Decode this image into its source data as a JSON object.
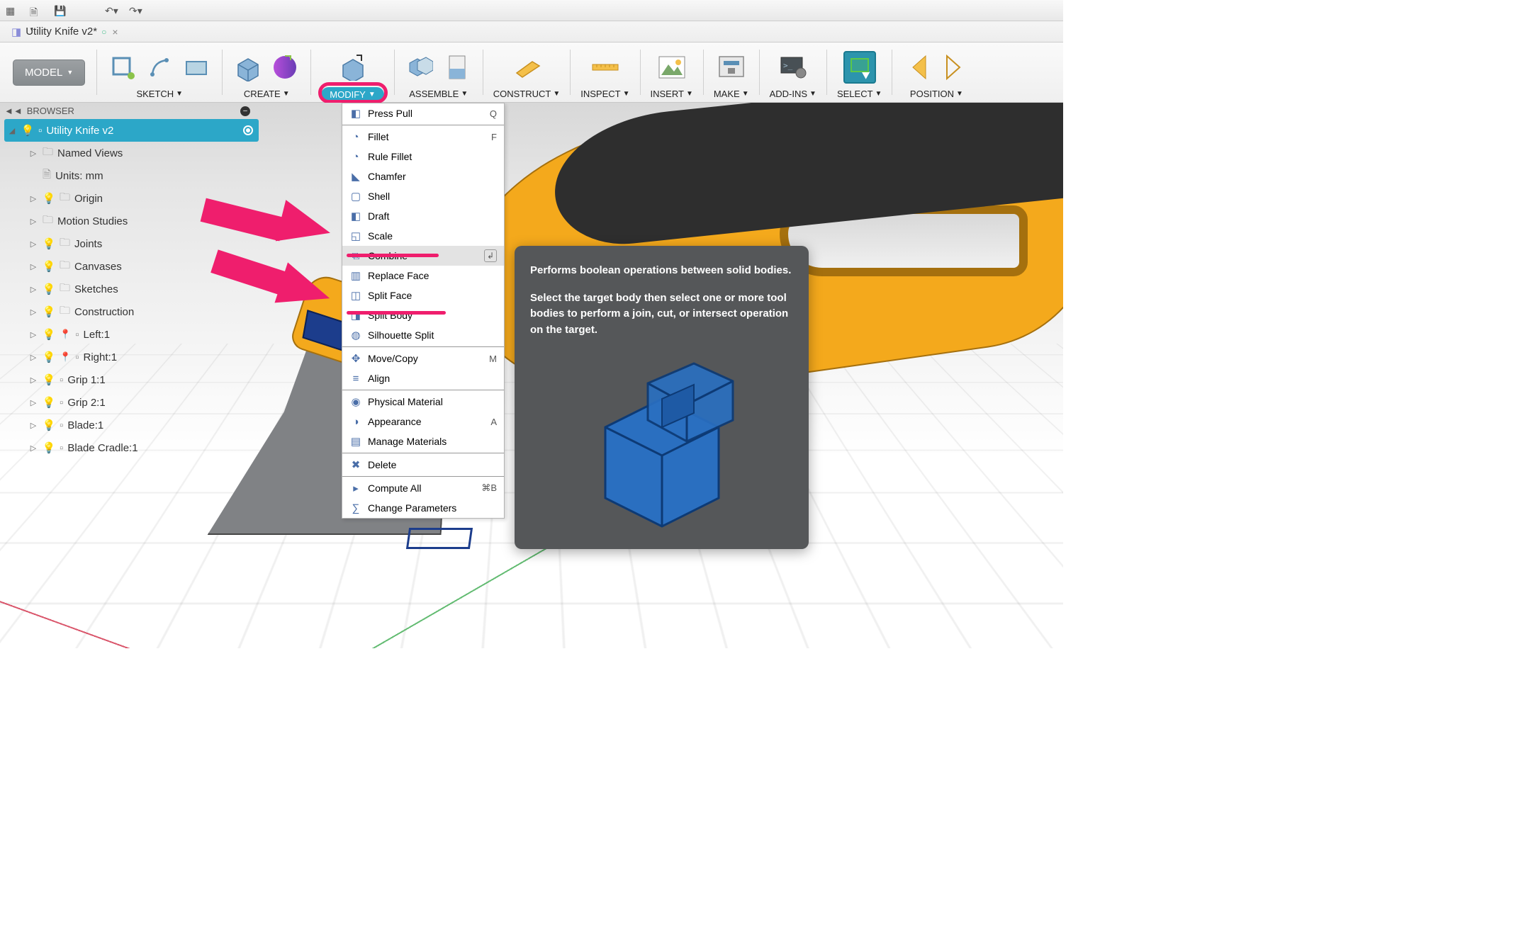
{
  "os_toolbar": {
    "icons": [
      "grid-icon",
      "new-doc-icon",
      "save-icon",
      "undo-icon",
      "redo-icon"
    ]
  },
  "tab": {
    "name": "Utility Knife v2*",
    "modified_indicator": "○",
    "close_label": "×"
  },
  "ribbon": {
    "model_button": "MODEL",
    "groups": [
      {
        "id": "sketch",
        "label": "SKETCH",
        "icons": [
          "sketch-create-icon",
          "sketch-spline-icon",
          "sketch-rect-icon"
        ]
      },
      {
        "id": "create",
        "label": "CREATE",
        "icons": [
          "extrude-icon",
          "sweep-icon"
        ]
      },
      {
        "id": "modify",
        "label": "MODIFY",
        "icons": [
          "presspull-icon"
        ]
      },
      {
        "id": "assemble",
        "label": "ASSEMBLE",
        "icons": [
          "joint-icon",
          "asbuilt-icon"
        ]
      },
      {
        "id": "construct",
        "label": "CONSTRUCT",
        "icons": [
          "plane-icon"
        ]
      },
      {
        "id": "inspect",
        "label": "INSPECT",
        "icons": [
          "measure-icon"
        ]
      },
      {
        "id": "insert",
        "label": "INSERT",
        "icons": [
          "image-icon"
        ]
      },
      {
        "id": "make",
        "label": "MAKE",
        "icons": [
          "print3d-icon"
        ]
      },
      {
        "id": "addins",
        "label": "ADD-INS",
        "icons": [
          "script-icon"
        ]
      },
      {
        "id": "select",
        "label": "SELECT",
        "icons": [
          "select-icon"
        ]
      },
      {
        "id": "position",
        "label": "POSITION",
        "icons": [
          "mirror-icon",
          "mirror2-icon"
        ]
      }
    ]
  },
  "browser": {
    "header_collapse_icon": "◄◄",
    "header_label": "BROWSER",
    "root": {
      "label": "Utility Knife v2"
    },
    "items": [
      {
        "type": "folder",
        "label": "Named Views",
        "expander": "▷",
        "indent": 1,
        "bulb": null
      },
      {
        "type": "doc",
        "label": "Units: mm",
        "expander": "",
        "indent": 1,
        "bulb": null
      },
      {
        "type": "folder",
        "label": "Origin",
        "expander": "▷",
        "indent": 1,
        "bulb": "off"
      },
      {
        "type": "folder",
        "label": "Motion Studies",
        "expander": "▷",
        "indent": 1,
        "bulb": null
      },
      {
        "type": "folder",
        "label": "Joints",
        "expander": "▷",
        "indent": 1,
        "bulb": "off"
      },
      {
        "type": "folder",
        "label": "Canvases",
        "expander": "▷",
        "indent": 1,
        "bulb": "off"
      },
      {
        "type": "folder",
        "label": "Sketches",
        "expander": "▷",
        "indent": 1,
        "bulb": "off"
      },
      {
        "type": "folder",
        "label": "Construction",
        "expander": "▷",
        "indent": 1,
        "bulb": "off"
      },
      {
        "type": "component",
        "label": "Left:1",
        "expander": "▷",
        "indent": 1,
        "bulb": "on",
        "pin": true
      },
      {
        "type": "component",
        "label": "Right:1",
        "expander": "▷",
        "indent": 1,
        "bulb": "on",
        "pin": true
      },
      {
        "type": "component",
        "label": "Grip 1:1",
        "expander": "▷",
        "indent": 1,
        "bulb": "on",
        "pin": false
      },
      {
        "type": "component",
        "label": "Grip 2:1",
        "expander": "▷",
        "indent": 1,
        "bulb": "on",
        "pin": false
      },
      {
        "type": "component",
        "label": "Blade:1",
        "expander": "▷",
        "indent": 1,
        "bulb": "on",
        "pin": false
      },
      {
        "type": "component",
        "label": "Blade Cradle:1",
        "expander": "▷",
        "indent": 1,
        "bulb": "on",
        "pin": false
      }
    ]
  },
  "dropdown": {
    "items": [
      {
        "label": "Press Pull",
        "icon": "◧",
        "shortcut": "Q",
        "hover": false
      },
      {
        "sep": true
      },
      {
        "label": "Fillet",
        "icon": "◔",
        "shortcut": "F"
      },
      {
        "label": "Rule Fillet",
        "icon": "◔"
      },
      {
        "label": "Chamfer",
        "icon": "◣"
      },
      {
        "label": "Shell",
        "icon": "▢"
      },
      {
        "label": "Draft",
        "icon": "◧"
      },
      {
        "label": "Scale",
        "icon": "◱"
      },
      {
        "label": "Combine",
        "icon": "⧉",
        "hover": true,
        "loop": "↲"
      },
      {
        "label": "Replace Face",
        "icon": "▥"
      },
      {
        "label": "Split Face",
        "icon": "◫"
      },
      {
        "label": "Split Body",
        "icon": "◨"
      },
      {
        "label": "Silhouette Split",
        "icon": "◍"
      },
      {
        "sep": true
      },
      {
        "label": "Move/Copy",
        "icon": "✥",
        "shortcut": "M"
      },
      {
        "label": "Align",
        "icon": "≡"
      },
      {
        "sep": true
      },
      {
        "label": "Physical Material",
        "icon": "◉"
      },
      {
        "label": "Appearance",
        "icon": "◑",
        "shortcut": "A"
      },
      {
        "label": "Manage Materials",
        "icon": "▤"
      },
      {
        "sep": true
      },
      {
        "label": "Delete",
        "icon": "✖"
      },
      {
        "sep": true
      },
      {
        "label": "Compute All",
        "icon": "▸",
        "shortcut": "⌘B"
      },
      {
        "label": "Change Parameters",
        "icon": "∑"
      }
    ]
  },
  "tooltip": {
    "line1": "Performs boolean operations between solid bodies.",
    "line2": "Select the target body then select one or more tool bodies to perform a join, cut, or intersect operation on the target."
  },
  "colors": {
    "accent_pink": "#ef1e6d",
    "accent_teal": "#2ca7c8",
    "knife_orange": "#f4a91c",
    "knife_blue": "#1c3d8c"
  }
}
